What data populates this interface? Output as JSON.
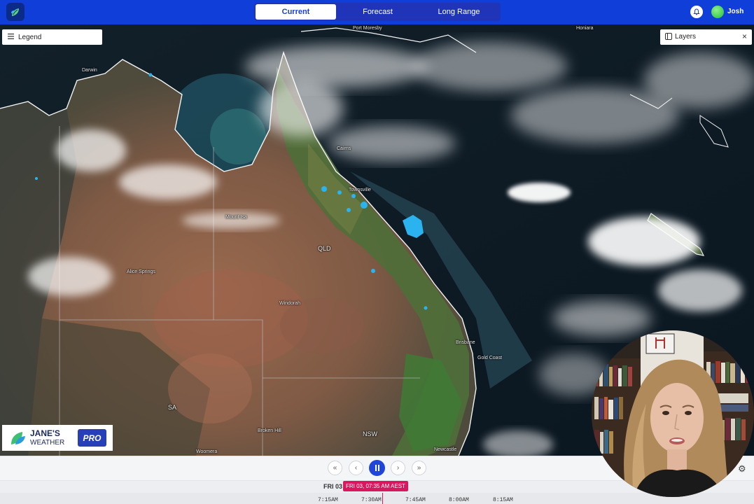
{
  "app": {
    "logo_icon": "leaf-logo-icon"
  },
  "tabs": [
    {
      "label": "Current",
      "active": true
    },
    {
      "label": "Forecast",
      "active": false
    },
    {
      "label": "Long Range",
      "active": false
    }
  ],
  "user": {
    "name": "Josh",
    "notification_icon": "bell-icon"
  },
  "legend": {
    "label": "Legend"
  },
  "layers": {
    "label": "Layers"
  },
  "map": {
    "places": {
      "port_moresby": "Port Moresby",
      "honiara": "Honiara",
      "darwin": "Darwin",
      "cairns": "Cairns",
      "townsville": "Townsville",
      "mount_isa": "Mount Isa",
      "alice_springs": "Alice Springs",
      "qld": "QLD",
      "windorah": "Windorah",
      "brisbane": "Brisbane",
      "gold_coast": "Gold Coast",
      "sa": "SA",
      "broken_hill": "Broken Hill",
      "nsw": "NSW",
      "woomera": "Woomera",
      "newcastle": "Newcastle"
    }
  },
  "brand": {
    "line1": "JANE'S",
    "line2": "WEATHER",
    "badge": "PRO"
  },
  "playback": {
    "day": "FRI 03",
    "current_time": "FRI 03, 07:35 AM AEST",
    "ticks": [
      "7:15AM",
      "7:30AM",
      "7:45AM",
      "8:00AM",
      "8:15AM"
    ]
  },
  "colors": {
    "primary": "#0f3fd8",
    "accent": "#d8175f",
    "rain": "#2bb3f0"
  }
}
